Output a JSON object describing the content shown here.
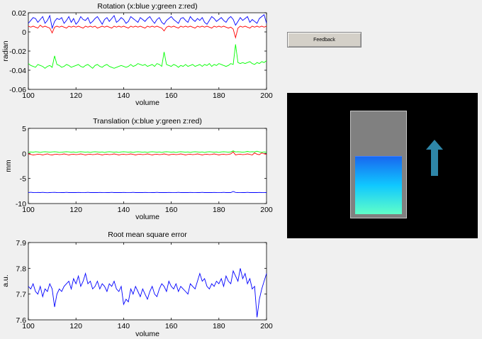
{
  "feedback_button": {
    "label": "Feedback"
  },
  "feedback_display": {
    "level": 0.58,
    "fill_color_top": "#1868f0",
    "fill_color_bottom": "#60ffc8",
    "arrow_color": "#2e86a8",
    "arrow_icon": "up-arrow-icon"
  },
  "chart_data": [
    {
      "type": "line",
      "title": "Rotation (x:blue y:green z:red)",
      "xlabel": "volume",
      "ylabel": "radian",
      "xlim": [
        100,
        200
      ],
      "ylim": [
        -0.06,
        0.02
      ],
      "xticks": [
        100,
        120,
        140,
        160,
        180,
        200
      ],
      "yticks": [
        0.02,
        0,
        -0.02,
        -0.04,
        -0.06
      ],
      "ytick_labels": [
        "0.02",
        "0",
        "-0.02",
        "-0.04",
        "-0.06"
      ],
      "grid": false,
      "x_start": 100,
      "series": [
        {
          "color": "#0000ff",
          "values": [
            0.009,
            0.012,
            0.015,
            0.014,
            0.01,
            0.013,
            0.016,
            0.009,
            0.012,
            0.017,
            0.004,
            0.011,
            0.014,
            0.013,
            0.015,
            0.009,
            0.012,
            0.016,
            0.01,
            0.014,
            0.008,
            0.011,
            0.016,
            0.013,
            0.012,
            0.015,
            0.009,
            0.011,
            0.014,
            0.016,
            0.012,
            0.008,
            0.013,
            0.015,
            0.011,
            0.014,
            0.017,
            0.01,
            0.012,
            0.015,
            0.013,
            0.009,
            0.011,
            0.016,
            0.014,
            0.012,
            0.01,
            0.015,
            0.013,
            0.011,
            0.014,
            0.016,
            0.012,
            0.009,
            0.013,
            0.015,
            0.01,
            0.008,
            0.012,
            0.014,
            0.016,
            0.013,
            0.011,
            0.009,
            0.014,
            0.015,
            0.012,
            0.01,
            0.016,
            0.013,
            0.011,
            0.014,
            0.012,
            0.015,
            0.01,
            0.008,
            0.012,
            0.016,
            0.014,
            0.011,
            0.013,
            0.015,
            0.012,
            0.01,
            0.014,
            0.016,
            0.013,
            0.007,
            0.011,
            0.015,
            0.012,
            0.014,
            0.016,
            0.01,
            0.013,
            0.011,
            0.009,
            0.014,
            0.016,
            0.018,
            0.009
          ]
        },
        {
          "color": "#00ff00",
          "values": [
            -0.033,
            -0.035,
            -0.036,
            -0.037,
            -0.034,
            -0.035,
            -0.036,
            -0.038,
            -0.036,
            -0.035,
            -0.037,
            -0.025,
            -0.034,
            -0.035,
            -0.037,
            -0.036,
            -0.034,
            -0.035,
            -0.037,
            -0.036,
            -0.035,
            -0.034,
            -0.036,
            -0.037,
            -0.035,
            -0.034,
            -0.036,
            -0.038,
            -0.035,
            -0.034,
            -0.036,
            -0.037,
            -0.035,
            -0.034,
            -0.036,
            -0.037,
            -0.038,
            -0.037,
            -0.036,
            -0.035,
            -0.036,
            -0.037,
            -0.036,
            -0.034,
            -0.036,
            -0.035,
            -0.033,
            -0.034,
            -0.035,
            -0.034,
            -0.036,
            -0.035,
            -0.034,
            -0.036,
            -0.033,
            -0.034,
            -0.036,
            -0.021,
            -0.034,
            -0.035,
            -0.036,
            -0.034,
            -0.035,
            -0.037,
            -0.035,
            -0.036,
            -0.034,
            -0.036,
            -0.035,
            -0.034,
            -0.036,
            -0.035,
            -0.034,
            -0.036,
            -0.034,
            -0.035,
            -0.033,
            -0.036,
            -0.034,
            -0.035,
            -0.033,
            -0.034,
            -0.035,
            -0.036,
            -0.035,
            -0.033,
            -0.034,
            -0.013,
            -0.032,
            -0.033,
            -0.032,
            -0.033,
            -0.032,
            -0.031,
            -0.033,
            -0.034,
            -0.032,
            -0.033,
            -0.031,
            -0.032,
            -0.03
          ]
        },
        {
          "color": "#ff0000",
          "values": [
            0.006,
            0.005,
            0.006,
            0.005,
            0.004,
            0.007,
            0.005,
            0.006,
            0.005,
            0.004,
            -0.001,
            0.005,
            0.006,
            0.005,
            0.006,
            0.005,
            0.004,
            0.006,
            0.005,
            0.006,
            0.005,
            0.006,
            0.005,
            0.004,
            0.006,
            0.005,
            0.006,
            0.005,
            0.006,
            0.004,
            0.005,
            0.006,
            0.005,
            0.006,
            0.005,
            0.004,
            0.006,
            0.005,
            0.006,
            0.005,
            0.006,
            0.005,
            0.004,
            0.006,
            0.005,
            0.006,
            0.005,
            0.006,
            0.005,
            0.004,
            0.006,
            0.005,
            0.006,
            0.005,
            0.006,
            0.005,
            0.004,
            0.001,
            0.005,
            0.006,
            0.005,
            0.006,
            0.005,
            0.004,
            0.006,
            0.005,
            0.006,
            0.005,
            0.006,
            0.005,
            0.004,
            0.006,
            0.005,
            0.006,
            0.005,
            0.006,
            0.005,
            0.004,
            0.006,
            0.005,
            0.006,
            0.005,
            0.006,
            0.005,
            0.004,
            0.005,
            0.003,
            -0.006,
            0.004,
            0.006,
            0.005,
            0.006,
            0.005,
            0.004,
            0.006,
            0.005,
            0.006,
            0.005,
            0.006,
            0.005,
            0.006
          ]
        }
      ]
    },
    {
      "type": "line",
      "title": "Translation (x:blue y:green z:red)",
      "xlabel": "volume",
      "ylabel": "mm",
      "xlim": [
        100,
        200
      ],
      "ylim": [
        -10,
        5
      ],
      "xticks": [
        100,
        120,
        140,
        160,
        180,
        200
      ],
      "yticks": [
        5,
        0,
        -5,
        -10
      ],
      "ytick_labels": [
        "5",
        "0",
        "-5",
        "-10"
      ],
      "grid": false,
      "x_start": 100,
      "series": [
        {
          "color": "#0000ff",
          "values": [
            -7.8,
            -7.75,
            -7.8,
            -7.82,
            -7.78,
            -7.8,
            -7.77,
            -7.8,
            -7.83,
            -7.8,
            -7.78,
            -7.76,
            -7.8,
            -7.82,
            -7.79,
            -7.8,
            -7.77,
            -7.8,
            -7.81,
            -7.79,
            -7.8,
            -7.78,
            -7.8,
            -7.82,
            -7.8,
            -7.77,
            -7.8,
            -7.79,
            -7.81,
            -7.8,
            -7.78,
            -7.8,
            -7.82,
            -7.79,
            -7.8,
            -7.77,
            -7.81,
            -7.8,
            -7.79,
            -7.8,
            -7.78,
            -7.8,
            -7.82,
            -7.8,
            -7.77,
            -7.8,
            -7.79,
            -7.81,
            -7.8,
            -7.78,
            -7.8,
            -7.82,
            -7.79,
            -7.8,
            -7.77,
            -7.81,
            -7.8,
            -7.79,
            -7.8,
            -7.78,
            -7.8,
            -7.82,
            -7.8,
            -7.77,
            -7.8,
            -7.79,
            -7.81,
            -7.8,
            -7.78,
            -7.8,
            -7.82,
            -7.79,
            -7.8,
            -7.77,
            -7.81,
            -7.8,
            -7.79,
            -7.8,
            -7.78,
            -7.8,
            -7.82,
            -7.8,
            -7.77,
            -7.8,
            -7.79,
            -7.81,
            -7.6,
            -7.78,
            -7.8,
            -7.82,
            -7.79,
            -7.8,
            -7.77,
            -7.81,
            -7.8,
            -7.79,
            -7.8,
            -7.78,
            -7.8,
            -7.82,
            -7.8
          ]
        },
        {
          "color": "#00ff00",
          "values": [
            0.2,
            0.3,
            0.25,
            0.35,
            0.3,
            0.2,
            0.3,
            0.35,
            0.3,
            0.25,
            0.3,
            0.35,
            0.3,
            0.2,
            0.25,
            0.3,
            0.35,
            0.3,
            0.25,
            0.3,
            0.2,
            0.3,
            0.35,
            0.3,
            0.25,
            0.3,
            0.2,
            0.3,
            0.35,
            0.3,
            0.25,
            0.3,
            0.2,
            0.3,
            0.35,
            0.3,
            0.25,
            0.3,
            0.2,
            0.3,
            0.35,
            0.3,
            0.25,
            0.3,
            0.2,
            0.3,
            0.35,
            0.3,
            0.25,
            0.3,
            0.2,
            0.3,
            0.35,
            0.3,
            0.25,
            0.3,
            0.2,
            0.3,
            0.35,
            0.3,
            0.25,
            0.3,
            0.2,
            0.3,
            0.35,
            0.3,
            0.25,
            0.3,
            0.2,
            0.3,
            0.35,
            0.3,
            0.25,
            0.3,
            0.2,
            0.3,
            0.35,
            0.3,
            0.25,
            0.3,
            0.2,
            0.3,
            0.35,
            0.3,
            0.25,
            0.3,
            0.5,
            0.3,
            0.35,
            0.3,
            0.25,
            0.3,
            0.4,
            0.3,
            0.35,
            0.3,
            0.45,
            0.3,
            0.2,
            0.3,
            0.25
          ]
        },
        {
          "color": "#ff0000",
          "values": [
            -0.1,
            -0.2,
            -0.3,
            -0.25,
            -0.15,
            -0.2,
            -0.3,
            -0.2,
            -0.1,
            -0.25,
            -0.3,
            -0.2,
            -0.15,
            -0.25,
            -0.2,
            -0.1,
            -0.2,
            -0.3,
            -0.2,
            -0.15,
            -0.25,
            -0.2,
            -0.1,
            -0.2,
            -0.3,
            -0.2,
            -0.15,
            -0.25,
            -0.2,
            -0.1,
            -0.2,
            -0.3,
            -0.2,
            -0.15,
            -0.25,
            -0.2,
            -0.1,
            -0.2,
            -0.3,
            -0.2,
            -0.15,
            -0.25,
            -0.2,
            -0.1,
            -0.2,
            -0.3,
            -0.2,
            -0.15,
            -0.25,
            -0.2,
            -0.1,
            -0.2,
            -0.3,
            -0.2,
            -0.15,
            -0.25,
            -0.2,
            -0.1,
            -0.2,
            -0.3,
            -0.2,
            -0.15,
            -0.25,
            -0.2,
            -0.1,
            -0.2,
            -0.3,
            -0.2,
            -0.15,
            -0.25,
            -0.2,
            -0.1,
            -0.2,
            -0.3,
            -0.2,
            -0.15,
            -0.25,
            -0.2,
            -0.1,
            -0.2,
            -0.3,
            -0.2,
            -0.15,
            -0.25,
            -0.2,
            -0.1,
            0.3,
            -0.3,
            -0.2,
            -0.15,
            -0.25,
            -0.2,
            -0.1,
            -0.2,
            -0.3,
            0.1,
            -0.15,
            -0.25,
            0.1,
            -0.1,
            -0.2
          ]
        }
      ]
    },
    {
      "type": "line",
      "title": "Root mean square error",
      "xlabel": "volume",
      "ylabel": "a.u.",
      "xlim": [
        100,
        200
      ],
      "ylim": [
        7.6,
        7.9
      ],
      "xticks": [
        100,
        120,
        140,
        160,
        180,
        200
      ],
      "yticks": [
        7.9,
        7.8,
        7.7,
        7.6
      ],
      "ytick_labels": [
        "7.9",
        "7.8",
        "7.7",
        "7.6"
      ],
      "grid": false,
      "x_start": 100,
      "series": [
        {
          "color": "#0000ff",
          "values": [
            7.73,
            7.72,
            7.74,
            7.71,
            7.7,
            7.73,
            7.69,
            7.72,
            7.71,
            7.74,
            7.72,
            7.65,
            7.7,
            7.72,
            7.71,
            7.73,
            7.74,
            7.75,
            7.72,
            7.76,
            7.74,
            7.77,
            7.73,
            7.75,
            7.78,
            7.74,
            7.75,
            7.72,
            7.73,
            7.75,
            7.72,
            7.74,
            7.73,
            7.71,
            7.74,
            7.73,
            7.75,
            7.72,
            7.71,
            7.73,
            7.66,
            7.68,
            7.67,
            7.72,
            7.7,
            7.73,
            7.71,
            7.69,
            7.72,
            7.7,
            7.68,
            7.71,
            7.73,
            7.7,
            7.69,
            7.72,
            7.74,
            7.73,
            7.71,
            7.75,
            7.73,
            7.72,
            7.74,
            7.71,
            7.73,
            7.72,
            7.71,
            7.7,
            7.74,
            7.73,
            7.72,
            7.75,
            7.78,
            7.75,
            7.76,
            7.73,
            7.72,
            7.74,
            7.73,
            7.75,
            7.74,
            7.76,
            7.73,
            7.77,
            7.75,
            7.74,
            7.79,
            7.77,
            7.75,
            7.8,
            7.76,
            7.78,
            7.74,
            7.76,
            7.72,
            7.73,
            7.61,
            7.68,
            7.72,
            7.75,
            7.78
          ]
        }
      ]
    }
  ]
}
